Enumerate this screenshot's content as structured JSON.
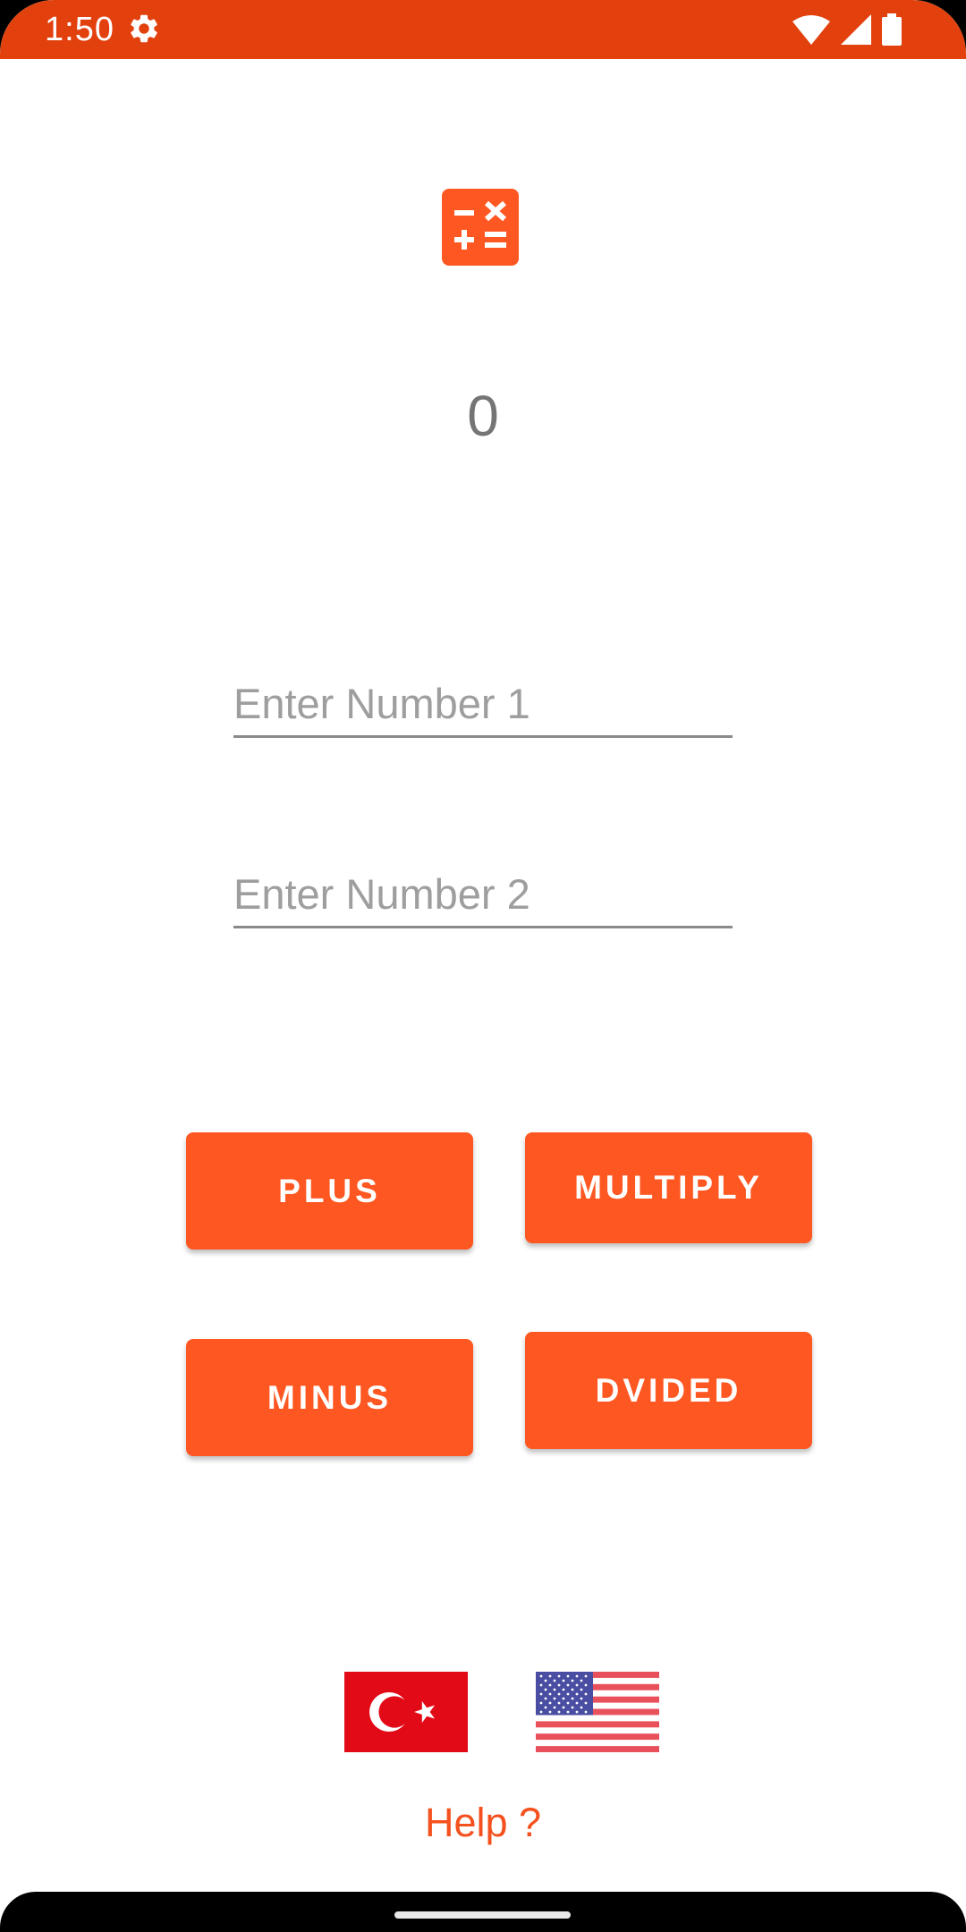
{
  "status_bar": {
    "time": "1:50",
    "icons": [
      "settings-icon",
      "wifi-icon",
      "cell-signal-icon",
      "battery-icon"
    ],
    "color": "#e2400c"
  },
  "app": {
    "icon": "calculator-icon",
    "accent": "#ff5722"
  },
  "result": {
    "value": "0"
  },
  "inputs": {
    "number1_placeholder": "Enter Number 1",
    "number1_value": "",
    "number2_placeholder": "Enter Number 2",
    "number2_value": ""
  },
  "buttons": {
    "plus": "PLUS",
    "multiply": "MULTIPLY",
    "minus": "MINUS",
    "divided": "DVIDED"
  },
  "languages": {
    "turkish_flag": "turkey-flag-icon",
    "english_flag": "usa-flag-icon"
  },
  "help": {
    "label": "Help ?",
    "color": "#f4511e"
  }
}
